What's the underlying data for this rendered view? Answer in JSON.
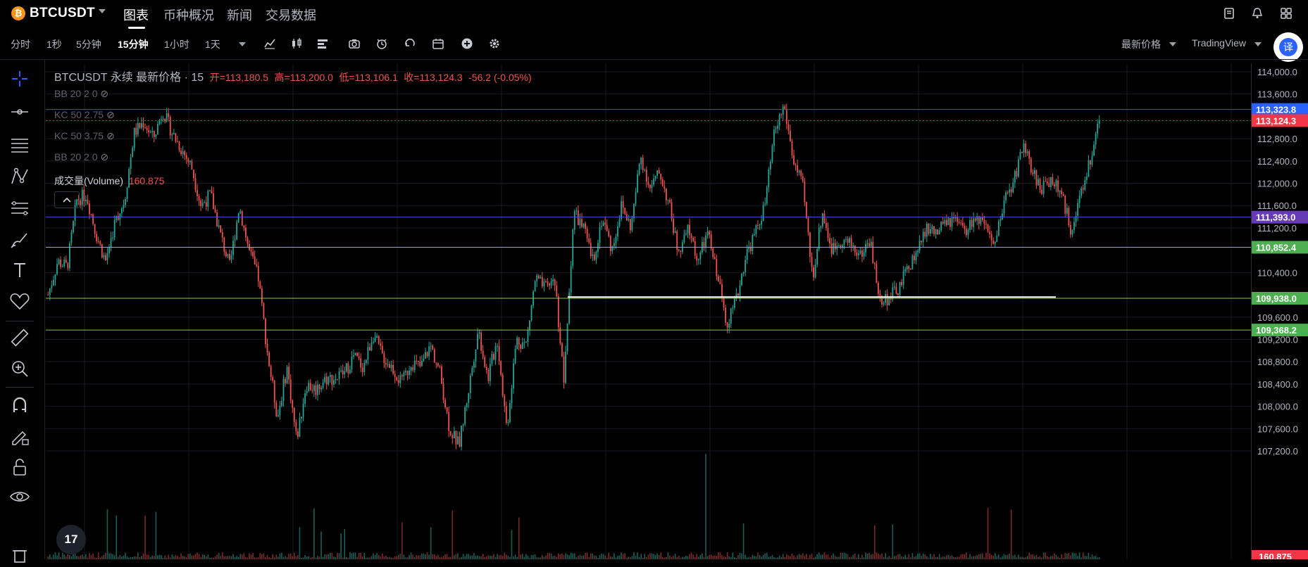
{
  "header": {
    "symbol": "BTCUSDT",
    "coin_icon": "₿",
    "tabs": [
      "图表",
      "币种概况",
      "新闻",
      "交易数据"
    ],
    "active_tab": "图表"
  },
  "toolbar": {
    "intervals": [
      "分时",
      "1秒",
      "5分钟",
      "15分钟",
      "1小时",
      "1天"
    ],
    "active_interval": "15分钟",
    "price_type": "最新价格",
    "view": "TradingView",
    "translate": "译"
  },
  "legend": {
    "title": "BTCUSDT 永续 最新价格 · 15",
    "open_label": "开=113,180.5",
    "high_label": "高=113,200.0",
    "low_label": "低=113,106.1",
    "close_label": "收=113,124.3",
    "change": "-56.2 (-0.05%)",
    "indicators": [
      "BB 20 2 0",
      "KC 50 2.75",
      "KC 50 3.75",
      "BB 20 2 0"
    ],
    "volume_label": "成交量(Volume)",
    "volume_value": "160.875"
  },
  "tv_logo": "17",
  "colors": {
    "up": "#26a69a",
    "down": "#ef5350",
    "blue_line": "#3f51d6",
    "green_line": "#8bc34a",
    "last_price": "#f23645"
  },
  "chart_data": {
    "type": "candlestick",
    "symbol": "BTCUSDT",
    "interval": "15m",
    "ylim": [
      107000,
      114200
    ],
    "yticks": [
      "114,000.0",
      "113,600.0",
      "112,800.0",
      "112,400.0",
      "112,000.0",
      "111,600.0",
      "111,200.0",
      "110,400.0",
      "109,600.0",
      "109,200.0",
      "108,800.0",
      "108,400.0",
      "108,000.0",
      "107,600.0",
      "107,200.0"
    ],
    "levels": [
      {
        "label": "113,323.8",
        "value": 113323.8,
        "color": "#2962ff"
      },
      {
        "label": "113,124.3",
        "value": 113124.3,
        "color": "#f23645"
      },
      {
        "label": "111,393.0",
        "value": 111393.0,
        "color": "#673ab7"
      },
      {
        "label": "110,852.4",
        "value": 110852.4,
        "color": "#4caf50"
      },
      {
        "label": "109,938.0",
        "value": 109938.0,
        "color": "#4caf50"
      },
      {
        "label": "109,368.2",
        "value": 109368.2,
        "color": "#4caf50"
      }
    ],
    "support_line": {
      "value": 109960
    },
    "close_path": [
      110000,
      110600,
      110500,
      111700,
      111800,
      111100,
      110600,
      111300,
      111700,
      112900,
      113100,
      112800,
      113300,
      112900,
      112600,
      112300,
      111600,
      111800,
      111100,
      110500,
      111600,
      110800,
      110300,
      108900,
      107800,
      108700,
      107400,
      108400,
      108300,
      108500,
      108500,
      108600,
      108900,
      108700,
      109300,
      108900,
      108700,
      108400,
      108800,
      108700,
      109100,
      108600,
      107600,
      107300,
      108300,
      109400,
      108500,
      109200,
      107600,
      109200,
      109100,
      110300,
      110100,
      110300,
      108400,
      111500,
      111200,
      110600,
      111400,
      110800,
      111600,
      111200,
      112500,
      111900,
      112200,
      111600,
      110700,
      111200,
      110600,
      111100,
      110400,
      109500,
      109900,
      110700,
      111100,
      111600,
      112900,
      113400,
      112400,
      111900,
      110300,
      111500,
      110800,
      111000,
      110900,
      110700,
      111000,
      109900,
      109950,
      110100,
      110500,
      110800,
      111200,
      111100,
      111300,
      111300,
      111100,
      111400,
      111200,
      110800,
      111700,
      112000,
      112700,
      112200,
      111900,
      112100,
      111800,
      111200,
      111700,
      112400,
      113124.3
    ],
    "volume_last": "160.875"
  }
}
